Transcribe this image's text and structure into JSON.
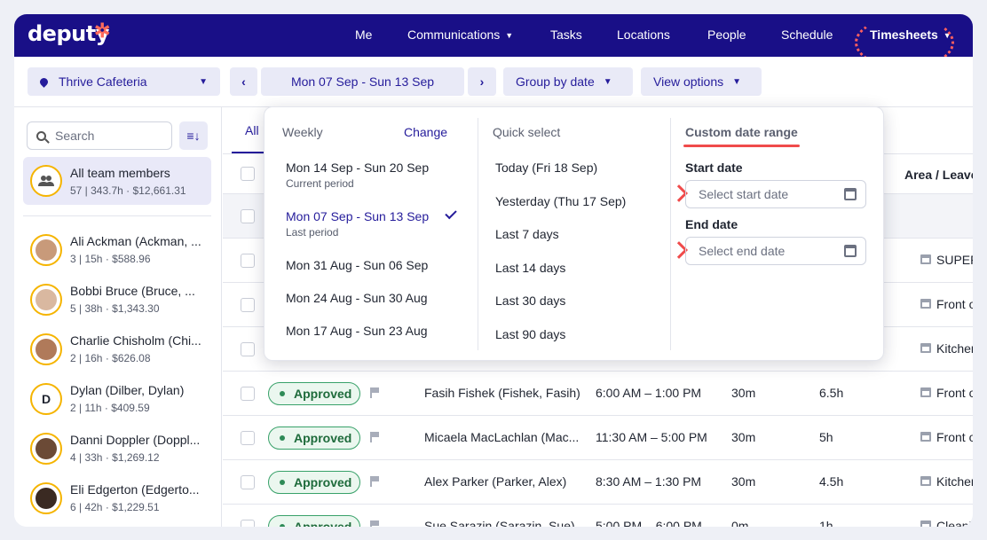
{
  "nav": {
    "logo": "deputy",
    "items": [
      "Me",
      "Communications",
      "Tasks",
      "Locations",
      "People",
      "Schedule",
      "Timesheets"
    ]
  },
  "toolbar": {
    "location": "Thrive Cafeteria",
    "date_range": "Mon 07 Sep - Sun 13 Sep",
    "group_by": "Group by date",
    "view_options": "View options"
  },
  "sidebar": {
    "search_placeholder": "Search",
    "all_members": {
      "name": "All team members",
      "summary": "57 | 343.7h · $12,661.31"
    },
    "members": [
      {
        "name": "Ali Ackman (Ackman, ...",
        "summary": "3 | 15h · $588.96"
      },
      {
        "name": "Bobbi Bruce (Bruce, ...",
        "summary": "5 | 38h · $1,343.30"
      },
      {
        "name": "Charlie Chisholm (Chi...",
        "summary": "2 | 16h · $626.08"
      },
      {
        "name": "Dylan (Dilber, Dylan)",
        "summary": "2 | 11h · $409.59",
        "initial": "D"
      },
      {
        "name": "Danni Doppler (Doppl...",
        "summary": "4 | 33h · $1,269.12"
      },
      {
        "name": "Eli Edgerton (Edgerto...",
        "summary": "6 | 42h · $1,229.51"
      }
    ]
  },
  "table": {
    "tab_all": "All",
    "area_header": "Area / Leave",
    "partial_areas": [
      "SUPERV",
      "Front of",
      "Kitchen,"
    ],
    "rows": [
      {
        "status": "Approved",
        "employee": "Fasih Fishek (Fishek, Fasih)",
        "time": "6:00 AM – 1:00 PM",
        "break": "30m",
        "hours": "6.5h",
        "area": "Front of"
      },
      {
        "status": "Approved",
        "employee": "Micaela MacLachlan (Mac...",
        "time": "11:30 AM – 5:00 PM",
        "break": "30m",
        "hours": "5h",
        "area": "Front of"
      },
      {
        "status": "Approved",
        "employee": "Alex Parker (Parker, Alex)",
        "time": "8:30 AM – 1:30 PM",
        "break": "30m",
        "hours": "4.5h",
        "area": "Kitchen,"
      },
      {
        "status": "Approved",
        "employee": "Sue Sarazin (Sarazin, Sue)",
        "time": "5:00 PM – 6:00 PM",
        "break": "0m",
        "hours": "1h",
        "area": "Cleanin"
      }
    ]
  },
  "dropdown": {
    "weekly_label": "Weekly",
    "change_label": "Change",
    "weekly": [
      {
        "label": "Mon 14 Sep - Sun 20 Sep",
        "sub": "Current period"
      },
      {
        "label": "Mon 07 Sep - Sun 13 Sep",
        "sub": "Last period"
      },
      {
        "label": "Mon 31 Aug - Sun 06 Sep"
      },
      {
        "label": "Mon 24 Aug - Sun 30 Aug"
      },
      {
        "label": "Mon 17 Aug - Sun 23 Aug"
      }
    ],
    "quick_label": "Quick select",
    "quick": [
      "Today (Fri 18 Sep)",
      "Yesterday (Thu 17 Sep)",
      "Last 7 days",
      "Last 14 days",
      "Last 30 days",
      "Last 90 days"
    ],
    "custom_label": "Custom date range",
    "start_label": "Start date",
    "start_placeholder": "Select start date",
    "end_label": "End date",
    "end_placeholder": "Select end date"
  },
  "colors": {
    "brand": "#190f87",
    "accent": "#251c9b",
    "highlight": "#f04b4b",
    "approved": "#38a169"
  }
}
